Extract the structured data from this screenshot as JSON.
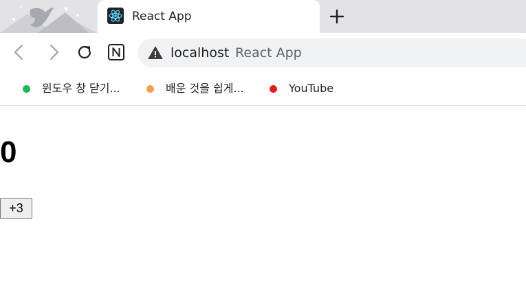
{
  "browser": {
    "tab": {
      "title": "React App",
      "favicon": "react-logo-icon"
    },
    "new_tab_icon": "plus-icon",
    "address_bar": {
      "security_icon": "warning-triangle-icon",
      "host": "localhost",
      "page_title": "React App"
    },
    "bookmarks": [
      {
        "label": "윈도우 창 닫기...",
        "dot_color": "#1db954"
      },
      {
        "label": "배운 것을 쉽게...",
        "dot_color": "#f0a04b"
      },
      {
        "label": "YouTube",
        "dot_color": "#e02020"
      }
    ]
  },
  "app": {
    "count": "0",
    "increment_label": "+3"
  },
  "colors": {
    "tabbar_bg": "#e3e3e6",
    "omnibox_bg": "#f1f2f4",
    "button_bg": "#efefef"
  }
}
